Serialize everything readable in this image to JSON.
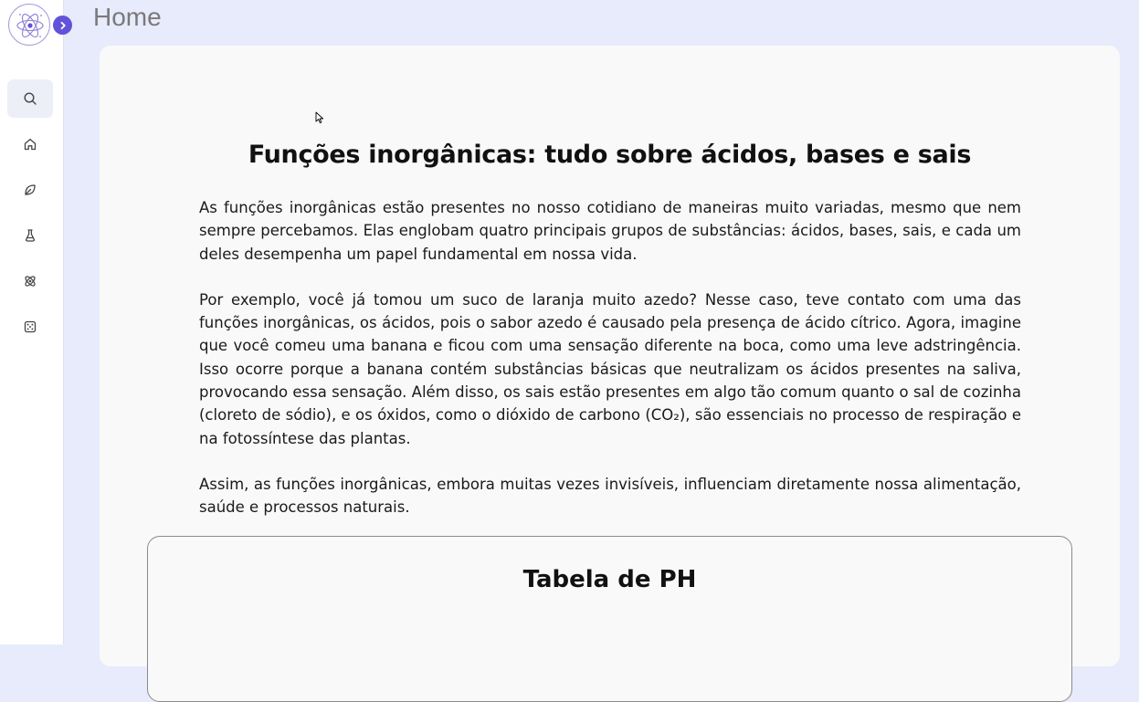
{
  "header": {
    "page_title": "Home"
  },
  "sidebar": {
    "logo_icon": "atom-logo-icon",
    "expand_icon": "chevron-right-icon",
    "items": [
      {
        "icon": "search-icon",
        "active": true
      },
      {
        "icon": "home-icon",
        "active": false
      },
      {
        "icon": "leaf-icon",
        "active": false
      },
      {
        "icon": "flask-icon",
        "active": false
      },
      {
        "icon": "atom-icon",
        "active": false
      },
      {
        "icon": "dice-icon",
        "active": false
      }
    ]
  },
  "article": {
    "title": "Funções inorgânicas: tudo sobre ácidos, bases e sais",
    "paragraphs": [
      "As funções inorgânicas estão presentes no nosso cotidiano de maneiras muito variadas, mesmo que nem sempre percebamos. Elas englobam quatro principais grupos de substâncias: ácidos, bases, sais, e cada um deles desempenha um papel fundamental em nossa vida.",
      "Por exemplo, você já tomou um suco de laranja muito azedo? Nesse caso, teve contato com uma das funções inorgânicas, os ácidos, pois o sabor azedo é causado pela presença de ácido cítrico. Agora, imagine que você comeu uma banana e ficou com uma sensação diferente na boca, como uma leve adstringência. Isso ocorre porque a banana contém substâncias básicas que neutralizam os ácidos presentes na saliva, provocando essa sensação. Além disso, os sais estão presentes em algo tão comum quanto o sal de cozinha (cloreto de sódio), e os óxidos, como o dióxido de carbono (CO₂), são essenciais no processo de respiração e na fotossíntese das plantas.",
      "Assim, as funções inorgânicas, embora muitas vezes invisíveis, influenciam diretamente nossa alimentação, saúde e processos naturais."
    ]
  },
  "ph_table": {
    "title": "Tabela de PH"
  },
  "colors": {
    "background": "#e8ebfb",
    "accent": "#6153d9",
    "card": "#f9f9f9"
  }
}
